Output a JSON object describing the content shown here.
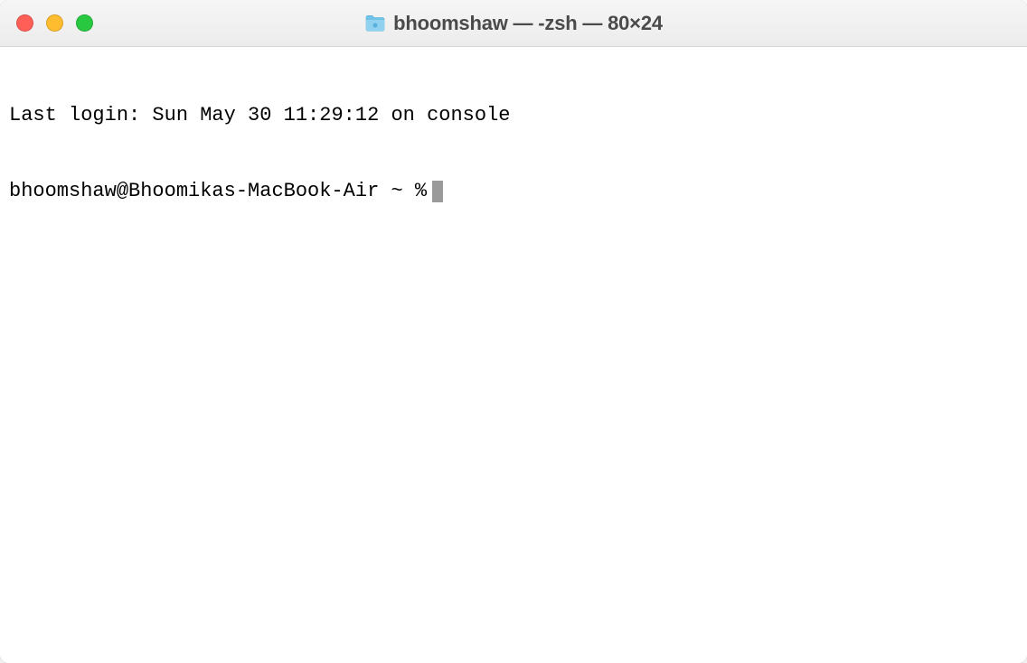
{
  "window": {
    "title": "bhoomshaw — -zsh — 80×24"
  },
  "terminal": {
    "last_login": "Last login: Sun May 30 11:29:12 on console",
    "prompt": "bhoomshaw@Bhoomikas-MacBook-Air ~ %"
  }
}
